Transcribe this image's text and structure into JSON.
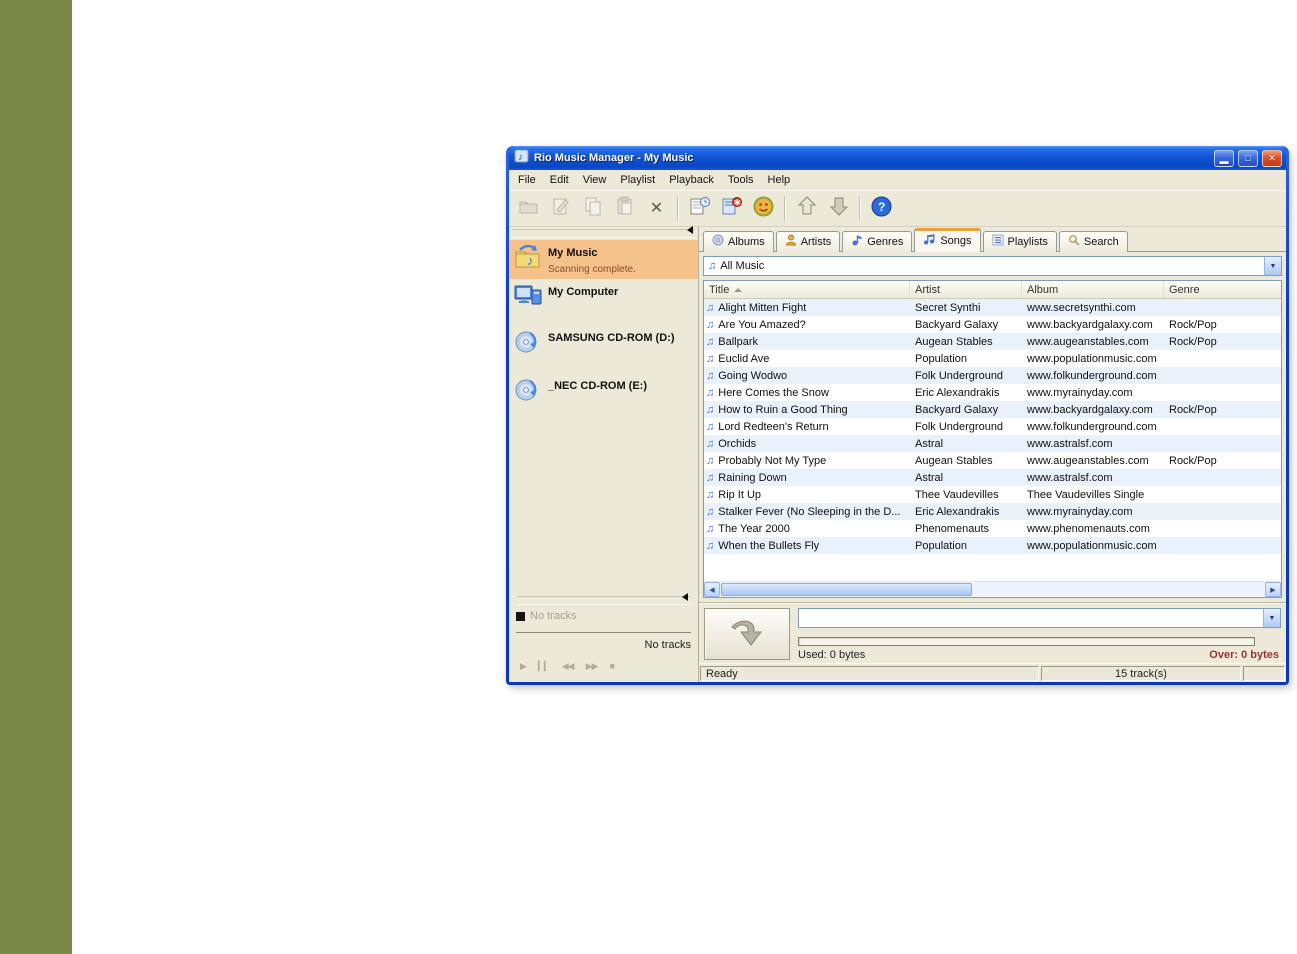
{
  "page": {
    "background": "#FFFFFF",
    "stripe_color": "#7A8849"
  },
  "titlebar": {
    "title": "Rio Music Manager - My Music",
    "app_icon": "rio-app-icon",
    "controls": [
      "minimize",
      "maximize",
      "close"
    ]
  },
  "menubar": {
    "items": [
      "File",
      "Edit",
      "View",
      "Playlist",
      "Playback",
      "Tools",
      "Help"
    ]
  },
  "toolbar": {
    "buttons": [
      "import",
      "edit",
      "copy",
      "paste",
      "delete",
      "properties",
      "edit-tags",
      "rio-smiley",
      "upload",
      "download",
      "help"
    ]
  },
  "sidebar": {
    "items": [
      {
        "label": "My Music",
        "status": "Scanning complete.",
        "icon": "my-music-icon",
        "selected": true
      },
      {
        "label": "My Computer",
        "status": "",
        "icon": "my-computer-icon",
        "selected": false
      },
      {
        "label": "SAMSUNG CD-ROM (D:)",
        "status": "",
        "icon": "cd-rom-icon",
        "selected": false
      },
      {
        "label": "_NEC CD-ROM (E:)",
        "status": "",
        "icon": "cd-rom-icon",
        "selected": false
      }
    ],
    "player": {
      "now_playing": "No tracks",
      "tracks_summary": "No tracks",
      "buttons": [
        "play",
        "pause",
        "rewind",
        "forward",
        "stop"
      ]
    }
  },
  "content": {
    "tabs": [
      {
        "label": "Albums",
        "icon": "album-icon",
        "active": false
      },
      {
        "label": "Artists",
        "icon": "artist-icon",
        "active": false
      },
      {
        "label": "Genres",
        "icon": "genre-icon",
        "active": false
      },
      {
        "label": "Songs",
        "icon": "songs-icon",
        "active": true
      },
      {
        "label": "Playlists",
        "icon": "playlist-icon",
        "active": false
      },
      {
        "label": "Search",
        "icon": "search-icon",
        "active": false
      }
    ],
    "filter": {
      "value": "All Music",
      "icon": "music-note-icon"
    },
    "table": {
      "columns": [
        "Title",
        "Artist",
        "Album",
        "Genre"
      ],
      "sort_column": "Title",
      "sort_direction": "ascending",
      "rows": [
        {
          "title": "Alight Mitten Fight",
          "artist": "Secret Synthi",
          "album": "www.secretsynthi.com",
          "genre": ""
        },
        {
          "title": "Are You Amazed?",
          "artist": "Backyard Galaxy",
          "album": "www.backyardgalaxy.com",
          "genre": "Rock/Pop"
        },
        {
          "title": "Ballpark",
          "artist": "Augean Stables",
          "album": "www.augeanstables.com",
          "genre": "Rock/Pop"
        },
        {
          "title": "Euclid Ave",
          "artist": "Population",
          "album": "www.populationmusic.com",
          "genre": ""
        },
        {
          "title": "Going Wodwo",
          "artist": "Folk Underground",
          "album": "www.folkunderground.com",
          "genre": ""
        },
        {
          "title": "Here Comes the Snow",
          "artist": "Eric Alexandrakis",
          "album": "www.myrainyday.com",
          "genre": ""
        },
        {
          "title": "How to Ruin a Good Thing",
          "artist": "Backyard Galaxy",
          "album": "www.backyardgalaxy.com",
          "genre": "Rock/Pop"
        },
        {
          "title": "Lord Redteen's Return",
          "artist": "Folk Underground",
          "album": "www.folkunderground.com",
          "genre": ""
        },
        {
          "title": "Orchids",
          "artist": "Astral",
          "album": "www.astralsf.com",
          "genre": ""
        },
        {
          "title": "Probably Not My Type",
          "artist": "Augean Stables",
          "album": "www.augeanstables.com",
          "genre": "Rock/Pop"
        },
        {
          "title": "Raining Down",
          "artist": "Astral",
          "album": "www.astralsf.com",
          "genre": ""
        },
        {
          "title": "Rip It Up",
          "artist": "Thee Vaudevilles",
          "album": "Thee Vaudevilles Single",
          "genre": ""
        },
        {
          "title": "Stalker Fever (No Sleeping in the D...",
          "artist": "Eric Alexandrakis",
          "album": "www.myrainyday.com",
          "genre": ""
        },
        {
          "title": "The Year 2000",
          "artist": "Phenomenauts",
          "album": "www.phenomenauts.com",
          "genre": ""
        },
        {
          "title": "When the Bullets Fly",
          "artist": "Population",
          "album": "www.populationmusic.com",
          "genre": ""
        }
      ]
    }
  },
  "transfer": {
    "device_value": "",
    "used": "Used: 0 bytes",
    "over": "Over: 0 bytes",
    "over_color": "#993333"
  },
  "statusbar": {
    "status": "Ready",
    "tracks": "15 track(s)"
  }
}
